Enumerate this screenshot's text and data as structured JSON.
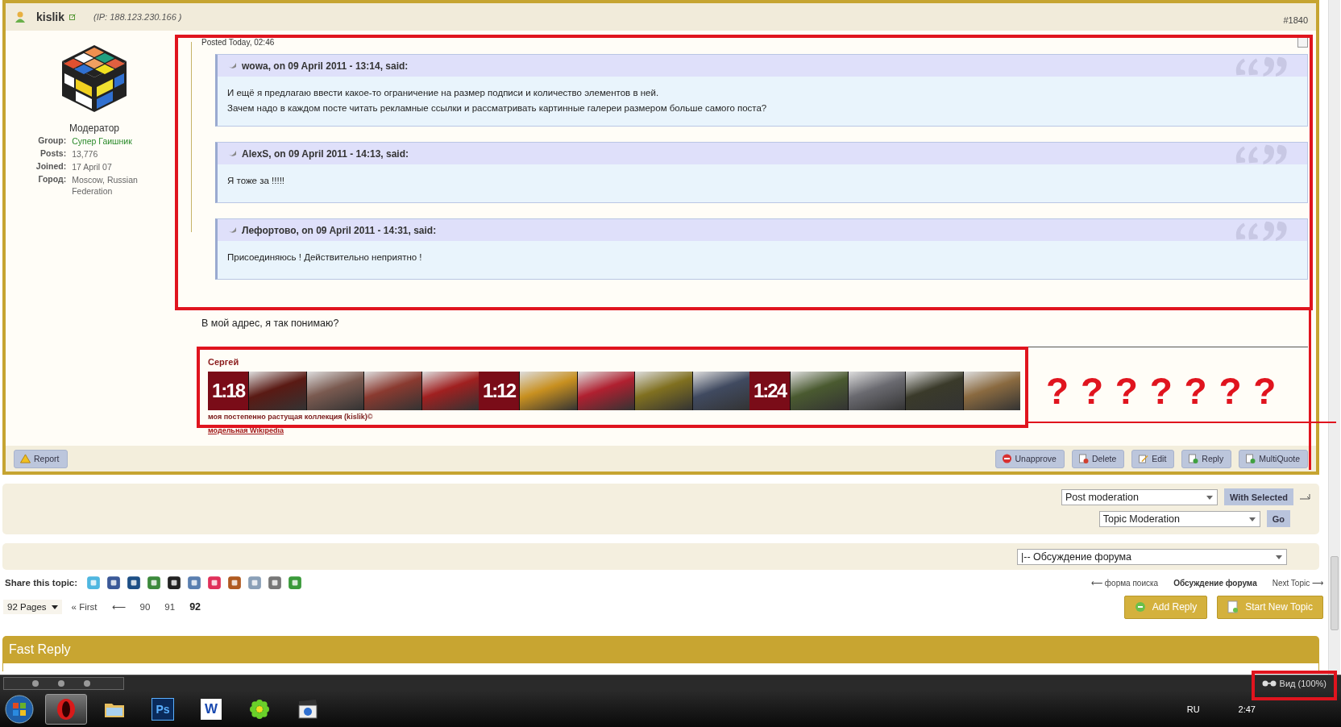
{
  "post": {
    "author": "kislik",
    "ip": "(IP: 188.123.230.166 )",
    "number": "#1840",
    "posted": "Posted Today, 02:46",
    "selected": false,
    "profile": {
      "title": "Модератор",
      "fields": [
        {
          "label": "Group:",
          "value": "Супер Гаишник",
          "kind": "group"
        },
        {
          "label": "Posts:",
          "value": "13,776",
          "kind": "plain"
        },
        {
          "label": "Joined:",
          "value": "17 April 07",
          "kind": "plain"
        },
        {
          "label": "Город:",
          "value": "Moscow, Russian Federation",
          "kind": "plain"
        }
      ]
    },
    "quotes": [
      {
        "header": "wowa, on 09 April 2011 - 13:14, said:",
        "lines": [
          "И ещё я предлагаю ввести какое-то ограничение на размер подписи и количество элементов в ней.",
          "Зачем надо в каждом посте читать рекламные ссылки и рассматривать картинные галереи размером больше самого поста?"
        ]
      },
      {
        "header": "AlexS, on 09 April 2011 - 14:13, said:",
        "lines": [
          "Я тоже за !!!!!"
        ]
      },
      {
        "header": "Лефортово, on 09 April 2011 - 14:31, said:",
        "lines": [
          "Присоединяюсь ! Действительно неприятно !"
        ]
      }
    ],
    "body": "В мой адрес, я так понимаю?",
    "signature": {
      "name": "Сергей",
      "banner": [
        {
          "kind": "scale",
          "label": "1:18"
        },
        {
          "kind": "photo"
        },
        {
          "kind": "photo"
        },
        {
          "kind": "photo"
        },
        {
          "kind": "photo"
        },
        {
          "kind": "scale",
          "label": "1:12"
        },
        {
          "kind": "photo"
        },
        {
          "kind": "photo"
        },
        {
          "kind": "photo"
        },
        {
          "kind": "photo"
        },
        {
          "kind": "scale",
          "label": "1:24"
        },
        {
          "kind": "photo"
        },
        {
          "kind": "photo"
        },
        {
          "kind": "photo"
        },
        {
          "kind": "photo"
        }
      ],
      "caption": "моя постепенно растущая коллекция (kislik)©",
      "link": "модельная Wikipedia"
    },
    "annotation": "? ? ? ? ? ? ?",
    "left_buttons": [
      {
        "label": "Report",
        "kind": "report"
      }
    ],
    "buttons": [
      {
        "label": "Unapprove",
        "kind": "unapprove"
      },
      {
        "label": "Delete",
        "kind": "delete"
      },
      {
        "label": "Edit",
        "kind": "edit"
      },
      {
        "label": "Reply",
        "kind": "reply"
      },
      {
        "label": "MultiQuote",
        "kind": "multiquote"
      }
    ]
  },
  "moderation": {
    "post_select": "Post moderation",
    "post_button": "With Selected",
    "topic_select": "Topic Moderation",
    "topic_button": "Go"
  },
  "forum_jump": "|-- Обсуждение форума",
  "share": {
    "label": "Share this topic:"
  },
  "topic_nav": [
    {
      "label": "⟵ форма поиска",
      "bold": false
    },
    {
      "label": "Обсуждение форума",
      "bold": true
    },
    {
      "label": "Next Topic ⟶",
      "bold": false
    }
  ],
  "pagination": {
    "menu": "92 Pages",
    "first": "« First",
    "prev": "⟵",
    "pages": [
      {
        "label": "90",
        "selected": false
      },
      {
        "label": "91",
        "selected": false
      },
      {
        "label": "92",
        "selected": true
      }
    ]
  },
  "actions": [
    {
      "label": "Add Reply",
      "kind": "reply"
    },
    {
      "label": "Start New Topic",
      "kind": "new"
    }
  ],
  "fast_reply": "Fast Reply",
  "status_bar": {
    "view": "Вид (100%)"
  },
  "taskbar": {
    "apps": [
      {
        "kind": "opera",
        "selected": true
      },
      {
        "kind": "folder",
        "selected": false
      },
      {
        "kind": "ps",
        "label": "Ps",
        "selected": false
      },
      {
        "kind": "word",
        "label": "W",
        "selected": false
      },
      {
        "kind": "icq",
        "selected": false
      },
      {
        "kind": "media",
        "selected": false
      }
    ],
    "lang": "RU",
    "time": "2:47"
  }
}
